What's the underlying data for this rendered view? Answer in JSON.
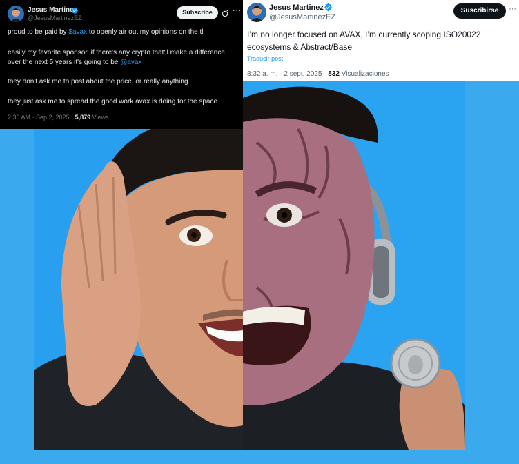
{
  "left_tweet": {
    "author_name": "Jesus Martinez",
    "handle": "@JesusMartinezEZ",
    "subscribe_label": "Subscribe",
    "more_label": "···",
    "lines": [
      {
        "pre": "proud to be paid by ",
        "link": "$avax",
        "post": " to openly air out my opinions on the tl"
      },
      {
        "pre": "easily my favorite sponsor, if there's any crypto that'll make a difference",
        "link": "",
        "post": ""
      },
      {
        "pre": "over the next 5 years it's going to be ",
        "link": "@avax",
        "post": ""
      },
      {
        "pre": "they don't ask me to post about the price, or really anything",
        "link": "",
        "post": ""
      },
      {
        "pre": "they just ask me to spread the good work avax is doing for the space",
        "link": "",
        "post": ""
      }
    ],
    "time": "2:30 AM · Sep 2, 2025 · ",
    "views_count": "5,879",
    "views_label": " Views"
  },
  "right_tweet": {
    "author_name": "Jesus Martinez",
    "handle": "@JesusMartinezEZ",
    "subscribe_label": "Suscribirse",
    "more_label": "···",
    "body": "I’m no longer focused on AVAX, I’m currently scoping ISO20022 ecosystems & Abstract/Base",
    "translate_label": "Traducir post",
    "time": "8:32 a. m. · 2 sept. 2025 · ",
    "views_count": "832",
    "views_label": " Visualizaciones"
  },
  "colors": {
    "background_blue": "#3aa9ee",
    "link_blue": "#1d9bf0",
    "verified_blue": "#1d9bf0"
  }
}
